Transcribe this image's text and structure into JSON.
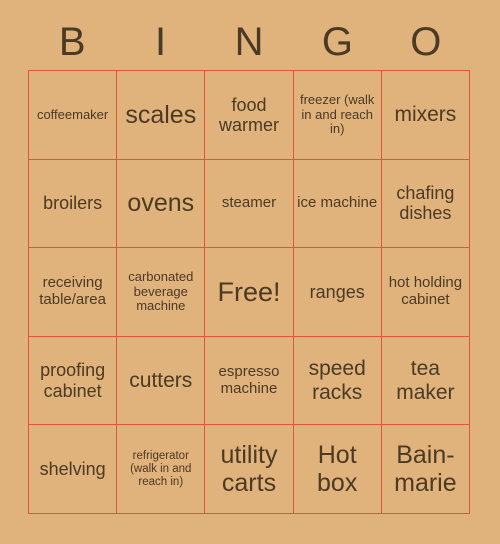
{
  "card": {
    "title_letters": [
      "B",
      "I",
      "N",
      "G",
      "O"
    ],
    "background_color": "#e0b27c",
    "grid_line_color": "#e2553c",
    "text_color": "#4b3a24",
    "rows": 5,
    "columns": 5,
    "free_space_label": "Free!",
    "free_space_position": "row3-col3"
  },
  "cells": [
    {
      "text": "coffeemaker",
      "size": "sz-s"
    },
    {
      "text": "scales",
      "size": "sz-xxl"
    },
    {
      "text": "food warmer",
      "size": "sz-l"
    },
    {
      "text": "freezer (walk in and reach in)",
      "size": "sz-s"
    },
    {
      "text": "mixers",
      "size": "sz-xl"
    },
    {
      "text": "broilers",
      "size": "sz-l"
    },
    {
      "text": "ovens",
      "size": "sz-xxl"
    },
    {
      "text": "steamer",
      "size": "sz-m"
    },
    {
      "text": "ice machine",
      "size": "sz-m"
    },
    {
      "text": "chafing dishes",
      "size": "sz-l"
    },
    {
      "text": "receiving table/area",
      "size": "sz-m"
    },
    {
      "text": "carbonated beverage machine",
      "size": "sz-s"
    },
    {
      "text": "Free!",
      "size": "sz-free"
    },
    {
      "text": "ranges",
      "size": "sz-l"
    },
    {
      "text": "hot holding cabinet",
      "size": "sz-m"
    },
    {
      "text": "proofing cabinet",
      "size": "sz-l"
    },
    {
      "text": "cutters",
      "size": "sz-xl"
    },
    {
      "text": "espresso machine",
      "size": "sz-m"
    },
    {
      "text": "speed racks",
      "size": "sz-xl"
    },
    {
      "text": "tea maker",
      "size": "sz-xl"
    },
    {
      "text": "shelving",
      "size": "sz-l"
    },
    {
      "text": "refrigerator (walk in and reach in)",
      "size": "sz-xs"
    },
    {
      "text": "utility carts",
      "size": "sz-xxl"
    },
    {
      "text": "Hot box",
      "size": "sz-xxl"
    },
    {
      "text": "Bain-marie",
      "size": "sz-xxl"
    }
  ]
}
